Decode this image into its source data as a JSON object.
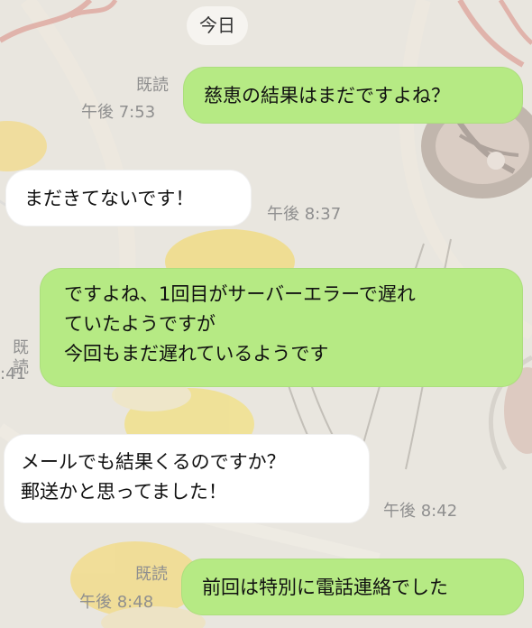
{
  "date_label": "今日",
  "messages": [
    {
      "direction": "outgoing",
      "text": "慈恵の結果はまだですよね？",
      "read": "既読",
      "time": "午後 7:53"
    },
    {
      "direction": "incoming",
      "text": "まだきてないです！",
      "time": "午後 8:37"
    },
    {
      "direction": "outgoing",
      "lines": [
        "ですよね、1回目がサーバーエラーで遅れ",
        "ていたようですが",
        "今回もまだ遅れているようです"
      ],
      "read": "既読",
      "time": ":41"
    },
    {
      "direction": "incoming",
      "lines": [
        "メールでも結果くるのですか？",
        "郵送かと思ってました！"
      ],
      "time": "午後 8:42"
    },
    {
      "direction": "outgoing",
      "text": "前回は特別に電話連絡でした",
      "read": "既読",
      "time": "午後 8:48"
    }
  ],
  "colors": {
    "outgoing_bubble": "#b6ea84",
    "incoming_bubble": "#ffffff",
    "meta_text": "#8f8f8f",
    "wallpaper": "#e9e6df"
  }
}
